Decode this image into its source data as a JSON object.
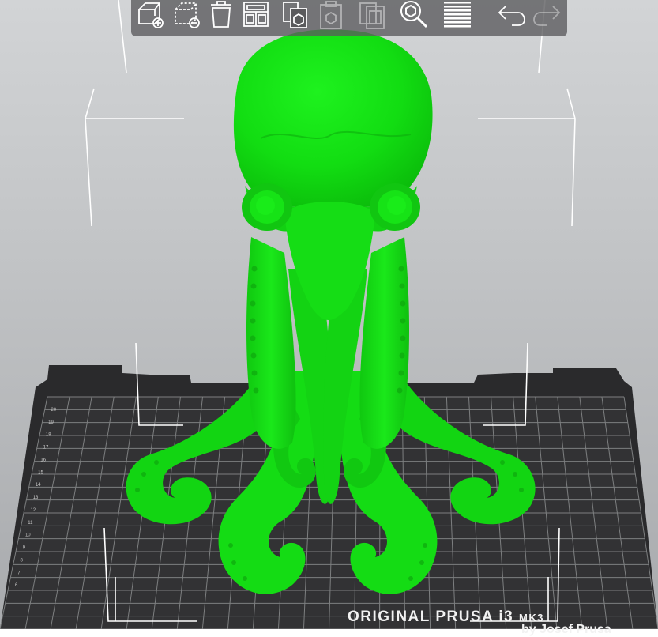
{
  "toolbar": {
    "buttons": [
      {
        "id": "add",
        "icon": "add-object-icon",
        "enabled": true
      },
      {
        "id": "delete",
        "icon": "delete-object-icon",
        "enabled": true
      },
      {
        "id": "delete-all",
        "icon": "trash-icon",
        "enabled": true
      },
      {
        "id": "arrange",
        "icon": "arrange-icon",
        "enabled": true
      },
      {
        "id": "copy",
        "icon": "copy-icon",
        "enabled": true
      },
      {
        "id": "paste",
        "icon": "paste-icon",
        "enabled": false
      },
      {
        "id": "instance",
        "icon": "add-instance-icon",
        "enabled": false
      },
      {
        "id": "search",
        "icon": "search-icon",
        "enabled": true
      },
      {
        "id": "layers",
        "icon": "layers-icon",
        "enabled": true
      },
      {
        "id": "undo",
        "icon": "undo-icon",
        "enabled": true
      },
      {
        "id": "redo",
        "icon": "redo-icon",
        "enabled": false
      }
    ]
  },
  "bed": {
    "brand": "ORIGINAL PRUSA i3",
    "model": "MK3",
    "author": "by Josef Prusa",
    "axis_ticks": [
      "20",
      "19",
      "18",
      "17",
      "16",
      "15",
      "14",
      "13",
      "12",
      "11",
      "10",
      "9",
      "8",
      "7",
      "6"
    ]
  },
  "model": {
    "name": "octopus-model",
    "color": "#16e016"
  },
  "colors": {
    "background": "#c4c6c8",
    "bed": "#2a2a2c",
    "grid": "#7d7f80",
    "selection_box": "#ffffff"
  }
}
